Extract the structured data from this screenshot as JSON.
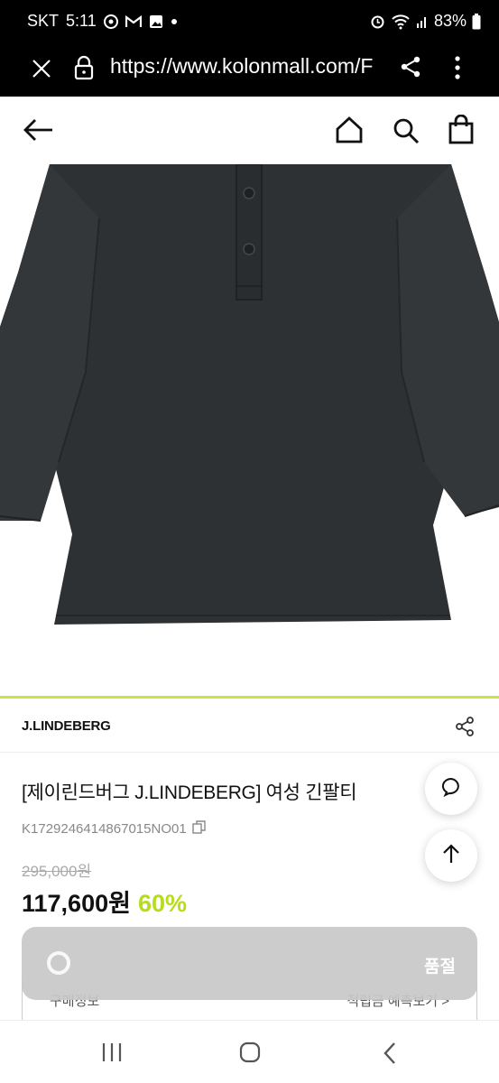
{
  "status_bar": {
    "carrier": "SKT",
    "time": "5:11",
    "battery": "83%",
    "icons": [
      "chrome-icon",
      "gmail-icon",
      "gallery-icon",
      "dot-icon",
      "alarm-icon",
      "wifi-icon",
      "signal-icon",
      "battery-icon"
    ]
  },
  "browser": {
    "url": "https://www.kolonmall.com/F",
    "icons": [
      "close-icon",
      "lock-icon",
      "share-icon",
      "more-icon"
    ]
  },
  "header": {
    "icons": [
      "back-arrow-icon",
      "home-icon",
      "search-icon",
      "cart-bag-icon"
    ]
  },
  "product": {
    "brand": "J.LINDEBERG",
    "title": "[제이린드버그 J.LINDEBERG] 여성 긴팔티",
    "code": "K1729246414867015NO01",
    "original_price": "295,000원",
    "current_price": "117,600원",
    "discount": "60%"
  },
  "under_row": {
    "left": "구매정보",
    "right": "적립금 예측보기 >"
  },
  "bottom_bar": {
    "soldout_label": "품절"
  },
  "colors": {
    "accent": "#c8e63c",
    "discount": "#b7dc1c",
    "garment": "#2e3133"
  }
}
